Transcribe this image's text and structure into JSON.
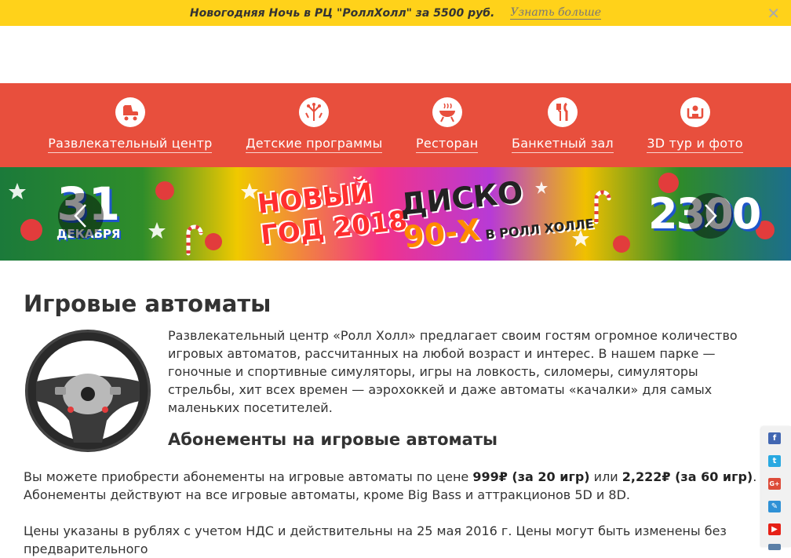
{
  "promo": {
    "text": "Новогодняя Ночь в РЦ \"РоллХолл\" за 5500 руб.",
    "link": "Узнать больше",
    "close": "✕"
  },
  "nav": {
    "items": [
      {
        "label": "Развлекательный центр",
        "icon": "roller-skate-icon"
      },
      {
        "label": "Детские программы",
        "icon": "fireworks-icon"
      },
      {
        "label": "Ресторан",
        "icon": "grill-icon"
      },
      {
        "label": "Банкетный зал",
        "icon": "cutlery-icon"
      },
      {
        "label": "3D тур и фото",
        "icon": "tour-360-icon"
      }
    ]
  },
  "banner": {
    "date_big": "31",
    "date_small": "ДЕКАБРЯ",
    "title_line1": "НОВЫЙ",
    "title_line2": "ГОД 2018",
    "disco": "ДИСКО",
    "disco_sub": "90-Х",
    "disco_where": "В РОЛЛ ХОЛЛЕ",
    "price": "2300"
  },
  "content": {
    "title": "Игровые автоматы",
    "intro": "Развлекательный центр «Ролл Холл» предлагает своим гостям огромное количество игровых автоматов, рассчитанных на любой возраст и интерес. В нашем парке — гоночные и спортивные симуляторы, игры на ловкость, силомеры, симуляторы стрельбы, хит всех времен — аэрохоккей и даже автоматы «качалки» для самых маленьких посетителей.",
    "subtitle": "Абонементы на игровые автоматы",
    "subs_part1": "Вы можете приобрести абонементы на игровые автоматы по цене ",
    "subs_price1": "999₽ (за 20 игр)",
    "subs_or": " или ",
    "subs_price2": "2,222₽ (за 60 игр)",
    "subs_part2": ". Абонементы действуют на все игровые автоматы, кроме Big Bass и аттракционов 5D и 8D.",
    "prices_note": "Цены указаны в рублях с учетом НДС и действительны на 25 мая 2016 г. Цены могут быть изменены без предварительного"
  },
  "social": [
    "facebook-icon",
    "twitter-icon",
    "google-plus-icon",
    "livejournal-icon",
    "youtube-icon",
    "vk-icon"
  ],
  "colors": {
    "promo_bg": "#ffd21a",
    "nav_bg": "#e84f3d"
  }
}
